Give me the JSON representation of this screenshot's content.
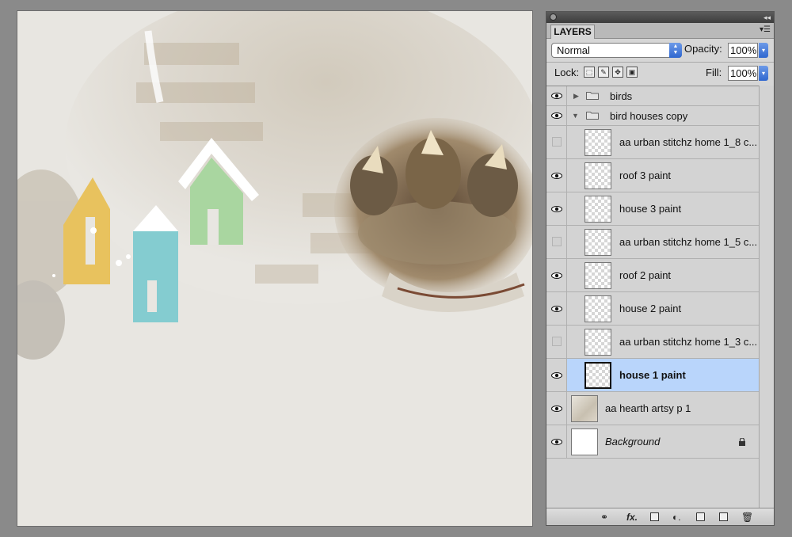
{
  "panel": {
    "tab_label": "LAYERS",
    "blend_mode": "Normal",
    "opacity_label": "Opacity:",
    "opacity_value": "100%",
    "lock_label": "Lock:",
    "fill_label": "Fill:",
    "fill_value": "100%"
  },
  "layers": [
    {
      "name": "birds",
      "kind": "group",
      "visible": true,
      "expanded": false
    },
    {
      "name": "bird houses copy",
      "kind": "group",
      "visible": true,
      "expanded": true
    },
    {
      "name": "aa urban stitchz home 1_8 c...",
      "kind": "layer",
      "visible": false
    },
    {
      "name": "roof 3 paint",
      "kind": "layer",
      "visible": true
    },
    {
      "name": "house 3 paint",
      "kind": "layer",
      "visible": true
    },
    {
      "name": "aa urban stitchz home 1_5 c...",
      "kind": "layer",
      "visible": false
    },
    {
      "name": "roof 2 paint",
      "kind": "layer",
      "visible": true
    },
    {
      "name": "house 2 paint",
      "kind": "layer",
      "visible": true
    },
    {
      "name": "aa urban stitchz home 1_3 c...",
      "kind": "layer",
      "visible": false
    },
    {
      "name": "house 1 paint",
      "kind": "layer",
      "visible": true,
      "selected": true
    },
    {
      "name": "aa hearth artsy p 1",
      "kind": "layer",
      "visible": true
    },
    {
      "name": "Background",
      "kind": "layer",
      "visible": true,
      "locked": true
    }
  ],
  "colors": {
    "selection": "#b9d5fb",
    "house1": "#e8c25e",
    "house2": "#84ccd0",
    "house3": "#a9d6a0"
  },
  "icons": [
    "eye-icon",
    "folder-icon",
    "lock-icon",
    "link-icon",
    "fx-icon",
    "mask-icon",
    "adjustment-icon",
    "new-group-icon",
    "new-layer-icon",
    "trash-icon"
  ]
}
